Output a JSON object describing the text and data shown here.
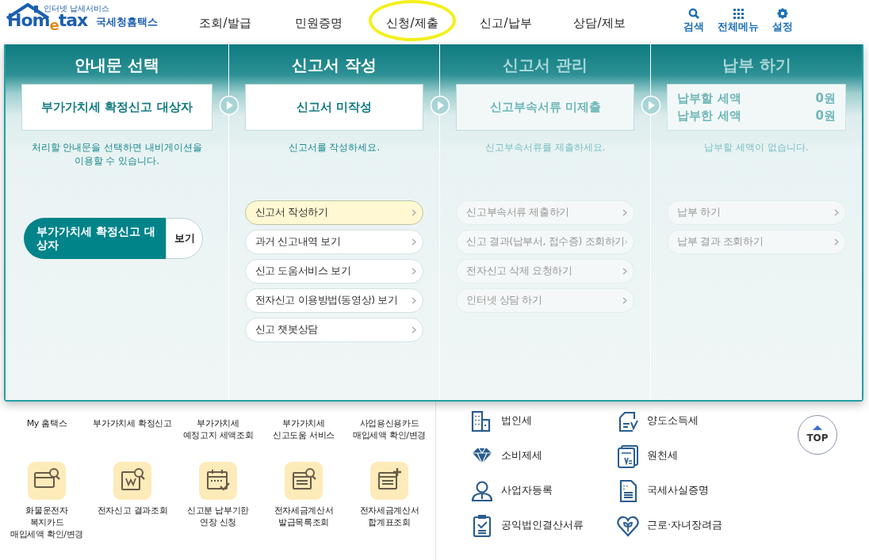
{
  "logo": {
    "tagline": "인터넷 납세서비스",
    "wordmark": "Hom$_{e}$tax",
    "name": "국세청홈택스"
  },
  "nav": [
    {
      "label": "조회/발급",
      "highlighted": false
    },
    {
      "label": "민원증명",
      "highlighted": false
    },
    {
      "label": "신청/제출",
      "highlighted": true
    },
    {
      "label": "신고/납부",
      "highlighted": false
    },
    {
      "label": "상담/제보",
      "highlighted": false
    }
  ],
  "tools": [
    {
      "label": "검색",
      "kind": "search"
    },
    {
      "label": "전체메뉴",
      "kind": "grid"
    },
    {
      "label": "설정",
      "kind": "gear"
    }
  ],
  "steps": [
    {
      "title": "안내문 선택",
      "active": true,
      "status": "부가가치세 확정신고 대상자",
      "description": "처리할 안내문을 선택하면 내비게이션을\n이용할 수 있습니다.",
      "notice": {
        "label": "부가가치세 확정신고 대상자",
        "action": "보기"
      }
    },
    {
      "title": "신고서 작성",
      "active": true,
      "status": "신고서 미작성",
      "description": "신고서를 작성하세요.",
      "actions": [
        {
          "label": "신고서 작성하기",
          "selected": true
        },
        {
          "label": "과거 신고내역 보기",
          "selected": false
        },
        {
          "label": "신고 도움서비스 보기",
          "selected": false
        },
        {
          "label": "전자신고 이용방법(동영상) 보기",
          "selected": false
        },
        {
          "label": "신고 챗봇상담",
          "selected": false
        }
      ]
    },
    {
      "title": "신고서 관리",
      "active": false,
      "status": "신고부속서류 미제출",
      "description": "신고부속서류를 제출하세요.",
      "actions": [
        {
          "label": "신고부속서류 제출하기",
          "selected": false
        },
        {
          "label": "신고 결과(납부서, 접수증) 조회하기",
          "selected": false
        },
        {
          "label": "전자신고 삭제 요청하기",
          "selected": false
        },
        {
          "label": "인터넷 상담 하기",
          "selected": false
        }
      ]
    },
    {
      "title": "납부 하기",
      "active": false,
      "amounts": [
        {
          "label": "납부할 세액",
          "value": "0원"
        },
        {
          "label": "납부한 세액",
          "value": "0원"
        }
      ],
      "description": "납부할 세액이 없습니다.",
      "actions": [
        {
          "label": "납부 하기",
          "selected": false
        },
        {
          "label": "납부 결과 조회하기",
          "selected": false
        }
      ]
    }
  ],
  "quick_menu": [
    {
      "label": "My 홈택스"
    },
    {
      "label": "부가가치세 확정신고"
    },
    {
      "label": "부가가치세\n예정고지 세액조회"
    },
    {
      "label": "부가가치세\n신고도움 서비스"
    },
    {
      "label": "사업용신용카드\n매입세액 확인/변경"
    },
    {
      "label": "화물운전자\n복지카드\n매입세액 확인/변경",
      "kind": "card"
    },
    {
      "label": "전자신고 결과조회",
      "kind": "receipt"
    },
    {
      "label": "신고분 납부기한\n연장 신청",
      "kind": "calendar"
    },
    {
      "label": "전자세금계산서\n발급목록조회",
      "kind": "invoice"
    },
    {
      "label": "전자세금계산서\n합계표조회",
      "kind": "summary"
    }
  ],
  "tax_links": [
    {
      "label": "법인세",
      "kind": "building"
    },
    {
      "label": "양도소득세",
      "kind": "document"
    },
    {
      "label": "소비제세",
      "kind": "gem"
    },
    {
      "label": "원천세",
      "kind": "receipt"
    },
    {
      "label": "사업자등록",
      "kind": "person"
    },
    {
      "label": "국세사실증명",
      "kind": "certificate"
    },
    {
      "label": "공익법인결산서류",
      "kind": "clipboard"
    },
    {
      "label": "근로·자녀장려금",
      "kind": "heart"
    }
  ],
  "top_button": "TOP"
}
